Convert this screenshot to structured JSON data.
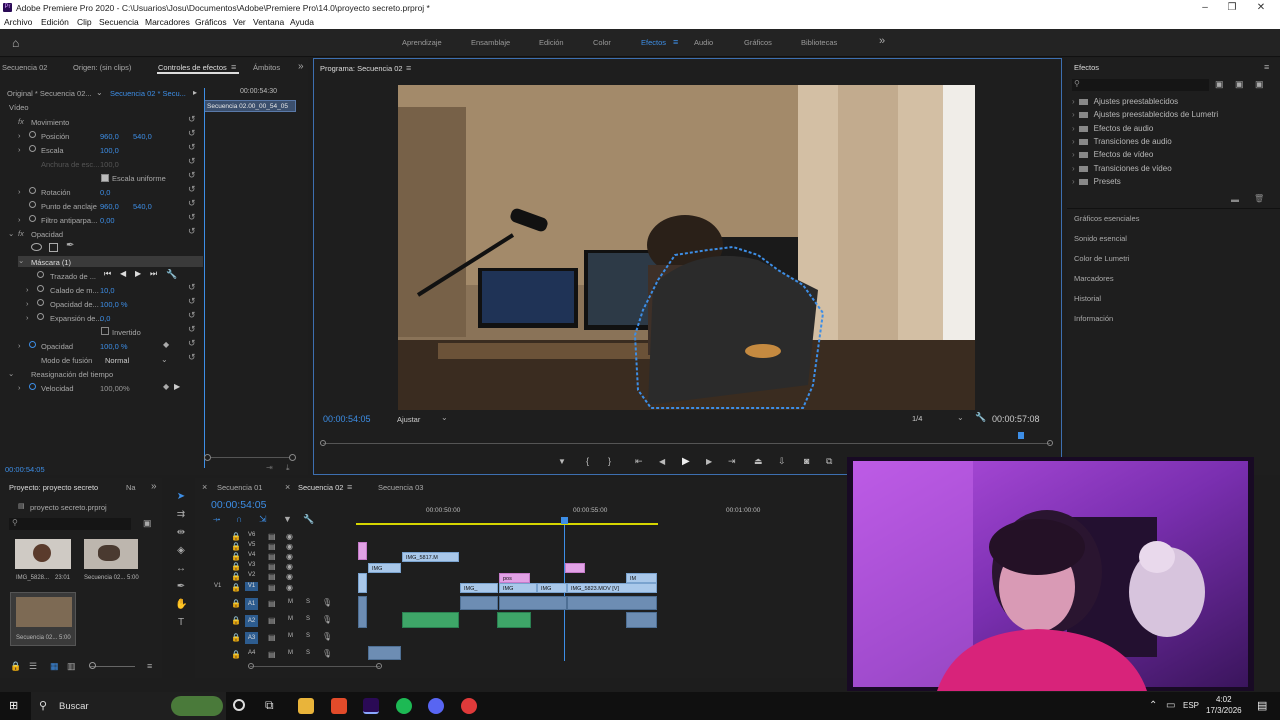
{
  "window": {
    "title": "Adobe Premiere Pro 2020 - C:\\Usuarios\\Josu\\Documentos\\Adobe\\Premiere Pro\\14.0\\proyecto secreto.prproj *"
  },
  "menu": [
    "Archivo",
    "Edición",
    "Clip",
    "Secuencia",
    "Marcadores",
    "Gráficos",
    "Ver",
    "Ventana",
    "Ayuda"
  ],
  "workspaces": {
    "tabs": [
      "Aprendizaje",
      "Ensamblaje",
      "Edición",
      "Color",
      "Efectos",
      "Audio",
      "Gráficos",
      "Bibliotecas"
    ],
    "active": "Efectos"
  },
  "source_panel": {
    "tabs": [
      "Secuencia 02",
      "Origen: (sin clips)",
      "Controles de efectos",
      "Ámbitos"
    ],
    "active": "Controles de efectos"
  },
  "effect_controls": {
    "source": "Original * Secuencia 02...",
    "target": "Secuencia 02 * Secu...",
    "mini_time": "00:00:54:30",
    "mini_clip": "Secuencia 02.00_00_54_05",
    "section_video": "Vídeo",
    "motion": "Movimiento",
    "position_label": "Posición",
    "position_x": "960,0",
    "position_y": "540,0",
    "scale_label": "Escala",
    "scale_val": "100,0",
    "scale_width_label": "Anchura de esc...",
    "scale_width_val": "100,0",
    "uniform_label": "Escala uniforme",
    "rotation_label": "Rotación",
    "rotation_val": "0,0",
    "anchor_label": "Punto de anclaje",
    "anchor_x": "960,0",
    "anchor_y": "540,0",
    "flicker_label": "Filtro antiparpa...",
    "flicker_val": "0,00",
    "opacity_section": "Opacidad",
    "mask_label": "Máscara (1)",
    "mask_path_label": "Trazado de ...",
    "mask_feather_label": "Calado de m...",
    "mask_feather_val": "10,0",
    "mask_opacity_label": "Opacidad de...",
    "mask_opacity_val": "100,0 %",
    "mask_expansion_label": "Expansión de...",
    "mask_expansion_val": "0,0",
    "inverted_label": "Invertido",
    "opacity_label": "Opacidad",
    "opacity_val": "100,0 %",
    "blend_label": "Modo de fusión",
    "blend_val": "Normal",
    "time_remap": "Reasignación del tiempo",
    "speed_label": "Velocidad",
    "speed_val": "100,00%",
    "bottom_time": "00:00:54:05"
  },
  "program": {
    "title": "Programa: Secuencia 02",
    "timecode": "00:00:54:05",
    "fit": "Ajustar",
    "quality": "1/4",
    "duration": "00:00:57:08",
    "playhead_fraction": 0.96
  },
  "effects_panel": {
    "title": "Efectos",
    "folders": [
      "Ajustes preestablecidos",
      "Ajustes preestablecidos de Lumetri",
      "Efectos de audio",
      "Transiciones de audio",
      "Efectos de vídeo",
      "Transiciones de vídeo",
      "Presets"
    ],
    "panels": [
      "Gráficos esenciales",
      "Sonido esencial",
      "Color de Lumetri",
      "Marcadores",
      "Historial",
      "Información"
    ]
  },
  "project": {
    "tabs": [
      "Proyecto: proyecto secreto",
      "Na"
    ],
    "file": "proyecto secreto.prproj",
    "items": [
      {
        "name": "IMG_5828...",
        "dur": "23:01"
      },
      {
        "name": "Secuencia 02...",
        "dur": "5:00"
      },
      {
        "name": "Secuencia 02...",
        "dur": "5:00"
      }
    ]
  },
  "timeline": {
    "tabs": [
      "Secuencia 01",
      "Secuencia 02",
      "Secuencia 03"
    ],
    "active": "Secuencia 02",
    "timecode": "00:00:54:05",
    "ruler": [
      "00:00:50:00",
      "00:00:55:00",
      "00:01:00:00"
    ],
    "tracks": [
      "V6",
      "V5",
      "V4",
      "V3",
      "V2",
      "V1",
      "A1",
      "A2",
      "A3",
      "A4"
    ],
    "src": "V1",
    "clips": {
      "c1": "IMG_5817.M",
      "c2": "IMG",
      "c3": "pos",
      "c4": "IMG_",
      "c5": "IMG",
      "c6": "IMG_5823.MOV [V]",
      "c7": "IM",
      "c8": "IMG"
    }
  },
  "taskbar": {
    "search": "Buscar",
    "lang": "ESP",
    "time": "4:02",
    "date": "17/3/2026"
  }
}
